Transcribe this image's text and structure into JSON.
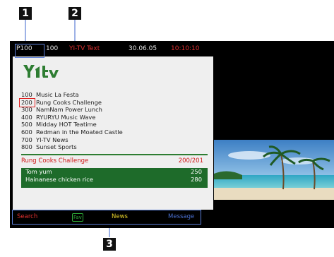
{
  "callouts": [
    "1",
    "2",
    "3"
  ],
  "status_bar": {
    "page": "P100",
    "current_page": "100",
    "service": "YI-TV Text",
    "date": "30.06.05",
    "time": "10:10:10"
  },
  "logo_text": "YI-TV",
  "program_list": [
    {
      "page": "100",
      "title": "Music La Festa"
    },
    {
      "page": "200",
      "title": "Rung Cooks Challenge"
    },
    {
      "page": "300",
      "title": "NamNam Power Lunch"
    },
    {
      "page": "400",
      "title": "RYURYU Music Wave"
    },
    {
      "page": "500",
      "title": "Midday HOT Teatime"
    },
    {
      "page": "600",
      "title": "Redman in the Moated Castle"
    },
    {
      "page": "700",
      "title": "YI-TV News"
    },
    {
      "page": "800",
      "title": "Sunset Sports"
    }
  ],
  "current_program": {
    "title": "Rung Cooks Challenge",
    "page_info": "200/201"
  },
  "sub_items": [
    {
      "name": "Tom yum",
      "price": "250"
    },
    {
      "name": "Hainanese chicken rice",
      "price": "280"
    }
  ],
  "fastext": {
    "red": "Search",
    "green": "Fav",
    "yellow": "News",
    "blue": "Message"
  },
  "colors": {
    "red": "#e03030",
    "green": "#2fae3a",
    "yellow": "#e8d22a",
    "blue": "#4a6fd0",
    "panel_green": "#1e6b2a"
  }
}
